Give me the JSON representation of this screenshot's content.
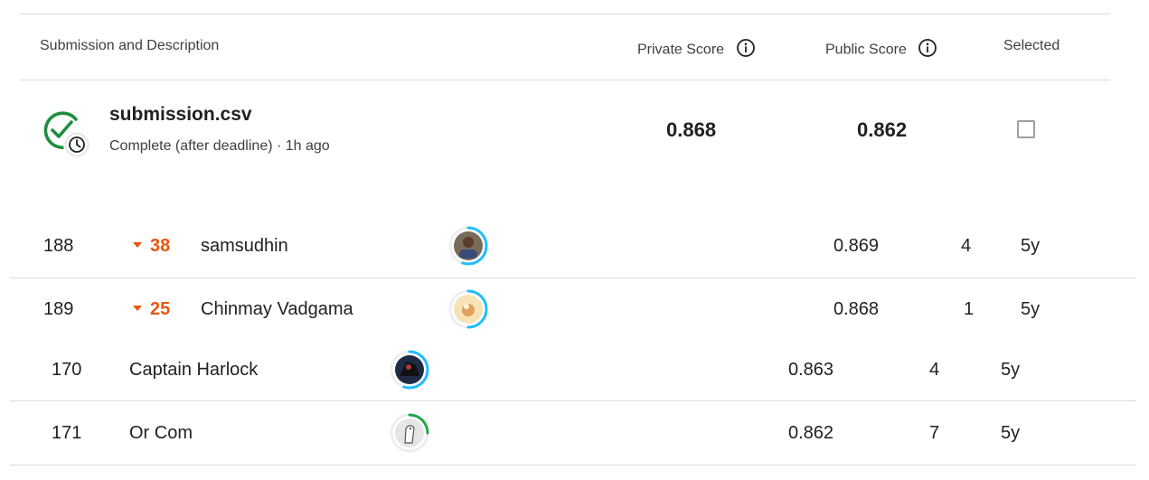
{
  "table_header": {
    "submission_col": "Submission and Description",
    "private_col": "Private Score",
    "public_col": "Public Score",
    "selected_col": "Selected"
  },
  "submission": {
    "file_name": "submission.csv",
    "status": "Complete (after deadline) · 1h ago",
    "private_score": "0.868",
    "public_score": "0.862",
    "selected": false
  },
  "leaderboard_a": [
    {
      "rank": "188",
      "change": "38",
      "name": "samsudhin",
      "score": "0.869",
      "entries": "4",
      "last": "5y",
      "ring_fraction": 0.55,
      "ring_color": "#20beff"
    },
    {
      "rank": "189",
      "change": "25",
      "name": "Chinmay Vadgama",
      "score": "0.868",
      "entries": "1",
      "last": "5y",
      "ring_fraction": 0.5,
      "ring_color": "#20beff"
    }
  ],
  "leaderboard_b": [
    {
      "rank": "170",
      "name": "Captain Harlock",
      "score": "0.863",
      "entries": "4",
      "last": "5y",
      "ring_fraction": 0.55,
      "ring_color": "#20beff"
    },
    {
      "rank": "171",
      "name": "Or Com",
      "score": "0.862",
      "entries": "7",
      "last": "5y",
      "ring_fraction": 0.25,
      "ring_color": "#20a94a"
    }
  ],
  "colors": {
    "rank_drop": "#e8570c",
    "complete_check": "#1e8e3e"
  }
}
